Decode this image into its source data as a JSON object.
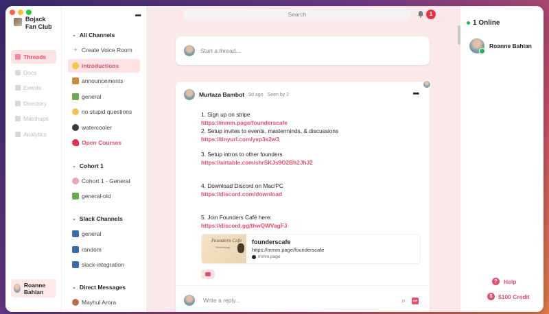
{
  "server": {
    "name": "Bojack Fan Club"
  },
  "nav": [
    {
      "label": "Threads",
      "icon": "pencil-icon",
      "active": true
    },
    {
      "label": "Docs",
      "icon": "doc-icon"
    },
    {
      "label": "Events",
      "icon": "calendar-icon"
    },
    {
      "label": "Directory",
      "icon": "directory-icon"
    },
    {
      "label": "Matchups",
      "icon": "matchups-icon"
    },
    {
      "label": "Analytics",
      "icon": "analytics-icon"
    }
  ],
  "me": {
    "name": "Roanne Bahian"
  },
  "channels": {
    "all_head": "All Channels",
    "create_voice": "Create Voice Room",
    "items": [
      {
        "label": "introductions",
        "icon": "wave-icon"
      },
      {
        "label": "announcements",
        "icon": "horn-icon"
      },
      {
        "label": "general",
        "icon": "house-icon"
      },
      {
        "label": "no stupid questions",
        "icon": "thinking-icon"
      },
      {
        "label": "watercooler",
        "icon": "skunk-icon"
      },
      {
        "label": "Open Courses",
        "icon": "heart-icon"
      }
    ],
    "cohort_head": "Cohort 1",
    "cohort_items": [
      {
        "label": "Cohort 1 - General",
        "icon": "brain-icon"
      },
      {
        "label": "general-old",
        "icon": "house-icon"
      }
    ],
    "slack_head": "Slack Channels",
    "slack_items": [
      {
        "label": "general",
        "icon": "scroll-icon"
      },
      {
        "label": "random",
        "icon": "scroll-icon"
      },
      {
        "label": "slack-integration",
        "icon": "scroll-icon"
      }
    ],
    "dm_head": "Direct Messages",
    "dm_items": [
      {
        "label": "Mayhul Arora",
        "icon": "person-icon"
      }
    ]
  },
  "header": {
    "search_placeholder": "Search",
    "notifications": "1"
  },
  "compose": {
    "placeholder": "Start a thread..."
  },
  "post": {
    "author": "Murtaza Bambot",
    "time": "9d ago",
    "seen": "Seen by 2",
    "lines": [
      "1. Sign up on stripe",
      "https://mmm.page/founderscafe",
      "2. Setup invites to events, masterminds, & discussions",
      "https://tinyurl.com/yvp3s2w3",
      "3. Setup intros to other founders",
      "https://airtable.com/shrSKJs9O2Bh2JhJ2",
      "4. Download Discord on Mac/PC",
      "https://discord.com/download",
      "5. Join Founders Café here:",
      "https://discord.gg/thwQWVagFJ"
    ],
    "embed": {
      "title": "founderscafe",
      "url": "https://mmm.page/founderscafe",
      "site": "mmm.page",
      "image_title": "Founders Cafe",
      "image_sub": "Wednesday"
    },
    "reply_placeholder": "Write a reply...",
    "gif_label": "GIF"
  },
  "online": {
    "head": "1 Online",
    "users": [
      {
        "name": "Roanne Bahian"
      }
    ]
  },
  "footer": {
    "help": "Help",
    "credit": "$100 Credit"
  },
  "colors": {
    "accent": "#e0506a",
    "active_bg": "#fde2e6",
    "main_bg": "#fbe9ea",
    "online": "#2ab050"
  }
}
